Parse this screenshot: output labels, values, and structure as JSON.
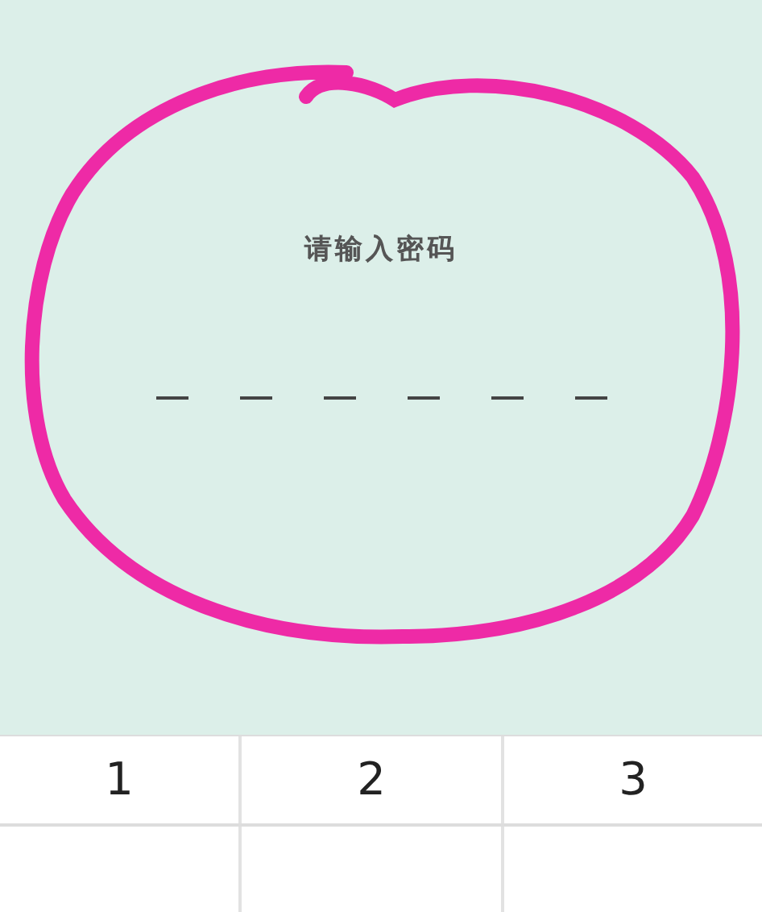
{
  "prompt": "请输入密码",
  "pin_slots": [
    {
      "filled": false
    },
    {
      "filled": false
    },
    {
      "filled": false
    },
    {
      "filled": false
    },
    {
      "filled": false
    },
    {
      "filled": false
    }
  ],
  "keypad": {
    "keys": [
      "1",
      "2",
      "3"
    ]
  }
}
